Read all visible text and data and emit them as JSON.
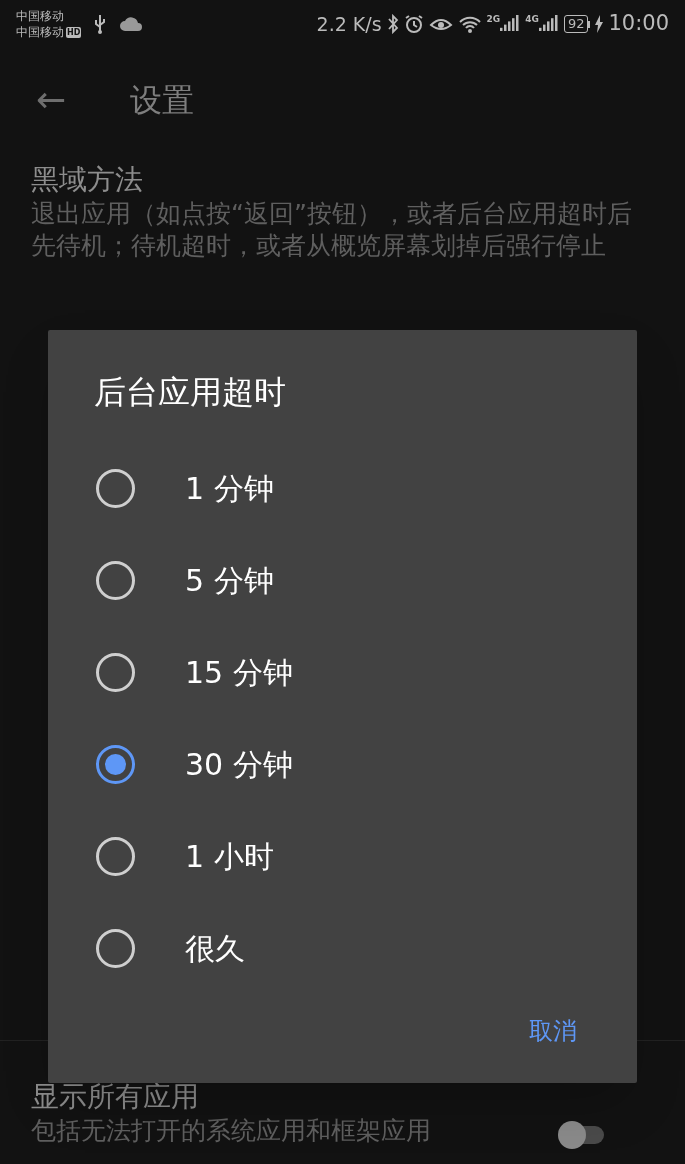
{
  "status_bar": {
    "carriers": [
      "中国移动",
      "中国移动"
    ],
    "hd_badge": "HD",
    "speed": "2.2 K/s",
    "network_labels": [
      "2G",
      "4G"
    ],
    "battery": "92",
    "time": "10:00"
  },
  "toolbar": {
    "back": "←",
    "title": "设置"
  },
  "settings": [
    {
      "kind": "text",
      "title": "黑域方法",
      "description": "退出应用（如点按“返回”按钮），或者后台应用超时后先待机；待机超时，或者从概览屏幕划掉后强行停止"
    },
    {
      "kind": "toggle",
      "title": "显示所有应用",
      "description": "包括无法打开的系统应用和框架应用",
      "on": false
    }
  ],
  "dialog": {
    "title": "后台应用超时",
    "options": [
      {
        "label": "1 分钟",
        "selected": false
      },
      {
        "label": "5 分钟",
        "selected": false
      },
      {
        "label": "15 分钟",
        "selected": false
      },
      {
        "label": "30 分钟",
        "selected": true
      },
      {
        "label": "1 小时",
        "selected": false
      },
      {
        "label": "很久",
        "selected": false
      }
    ],
    "cancel": "取消"
  }
}
